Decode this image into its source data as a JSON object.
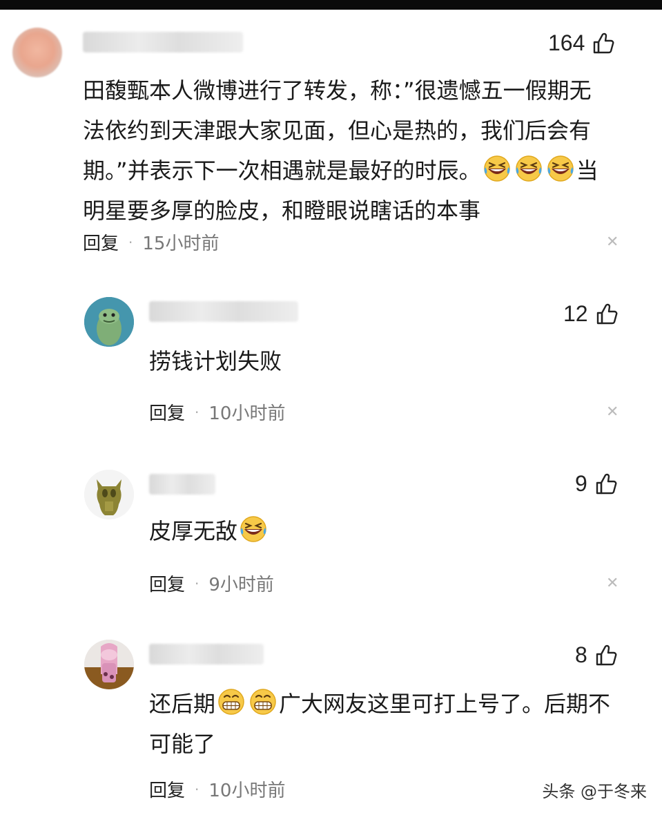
{
  "comments": [
    {
      "likes": "164",
      "text_lines": [
        "田馥甄本人微博进行了转发，称：”很遗憾五一假期无",
        "法依约到天津跟大家见面，但心是热的，我们后会有",
        "期。”并表示下一次相遇就是最好的时辰。",
        "明星要多厚的脸皮，和瞪眼说瞎话的本事"
      ],
      "line3_tail": "当",
      "reply": "回复",
      "time": "15小时前"
    },
    {
      "likes": "12",
      "text": "捞钱计划失败",
      "reply": "回复",
      "time": "10小时前"
    },
    {
      "likes": "9",
      "text": "皮厚无敌",
      "reply": "回复",
      "time": "9小时前"
    },
    {
      "likes": "8",
      "text_a": "还后期",
      "text_b": "广大网友这里可打上号了。后期不",
      "text_c": "可能了",
      "reply": "回复",
      "time": "10小时前"
    }
  ],
  "watermark": "头条 @于冬来",
  "icons": {
    "like": "thumbs-up-icon",
    "close": "close-icon",
    "emoji_laugh": "laughing-crying-emoji",
    "emoji_grin": "grinning-emoji"
  },
  "colors": {
    "text": "#1a1a1a",
    "meta": "#777777",
    "close": "#bbbbbb"
  }
}
